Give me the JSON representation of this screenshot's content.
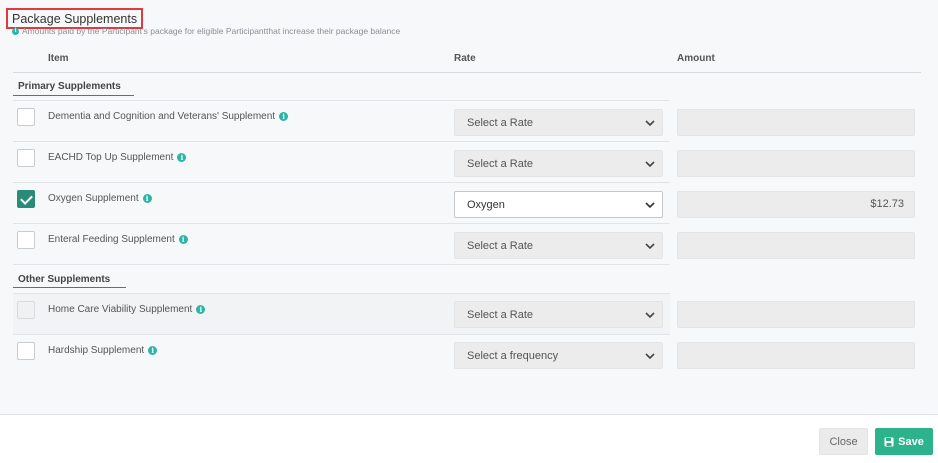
{
  "header": {
    "title": "Package Supplements",
    "subtitle": "Amounts paid by the Participant's package for eligible Participantthat increase their package balance"
  },
  "columns": {
    "item": "Item",
    "rate": "Rate",
    "amount": "Amount"
  },
  "sections": {
    "primary": "Primary Supplements",
    "other": "Other Supplements"
  },
  "rows": [
    {
      "label": "Dementia and Cognition and Veterans' Supplement",
      "checked": false,
      "disabled": false,
      "rate": "Select a Rate",
      "amount": ""
    },
    {
      "label": "EACHD Top Up Supplement",
      "checked": false,
      "disabled": false,
      "rate": "Select a Rate",
      "amount": ""
    },
    {
      "label": "Oxygen Supplement",
      "checked": true,
      "disabled": false,
      "rate": "Oxygen",
      "amount": "$12.73"
    },
    {
      "label": "Enteral Feeding Supplement",
      "checked": false,
      "disabled": false,
      "rate": "Select a Rate",
      "amount": ""
    },
    {
      "label": "Home Care Viability Supplement",
      "checked": false,
      "disabled": true,
      "rate": "Select a Rate",
      "amount": ""
    },
    {
      "label": "Hardship Supplement",
      "checked": false,
      "disabled": false,
      "rate": "Select a frequency",
      "amount": ""
    }
  ],
  "footer": {
    "close_label": "Close",
    "save_label": "Save"
  },
  "colors": {
    "accent": "#2db38c",
    "checked": "#2a8c78",
    "highlight": "#e0393e",
    "info": "#2bb5a6"
  },
  "icons": {
    "info": "info-icon",
    "dropdown": "chevron-down-icon",
    "save": "floppy-disk-icon",
    "check": "check-icon"
  }
}
